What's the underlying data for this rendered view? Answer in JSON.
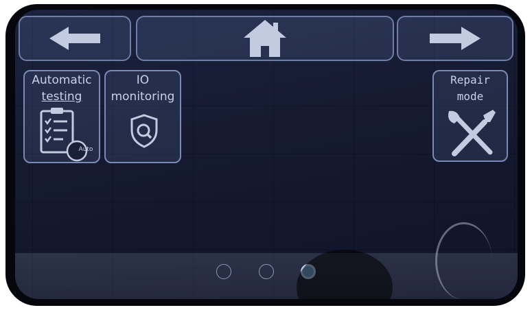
{
  "nav": {
    "back": {
      "icon": "arrow-left-icon"
    },
    "home": {
      "icon": "home-icon"
    },
    "forward": {
      "icon": "arrow-right-icon"
    }
  },
  "tiles": [
    {
      "label": "Automatic testing",
      "line1": "Automatic",
      "line2": "testing",
      "icon": "clipboard-checklist-icon",
      "badge": "Auto"
    },
    {
      "label": "IO monitoring",
      "line1": "IO",
      "line2": "monitoring",
      "icon": "shield-search-icon"
    },
    {
      "label": "Repair mode",
      "line1": "Repair",
      "line2": "mode",
      "icon": "wrench-screwdriver-icon"
    }
  ],
  "pagination": {
    "pages": 3,
    "current": 3
  },
  "colors": {
    "icon": "#c3cbe0",
    "border": "#7c8bb5",
    "accent": "#6fa0d8"
  }
}
